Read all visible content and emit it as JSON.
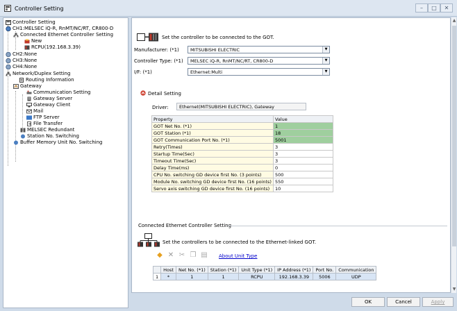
{
  "window": {
    "title": "Controller Setting",
    "icon": "controller-settings-icon"
  },
  "tree": {
    "items": [
      {
        "label": "Controller Setting",
        "icon": "controller-settings-icon"
      },
      {
        "label": "CH1:MELSEC iQ-R, RnMT/NC/RT, CR800-D",
        "icon": "channel-globe-icon"
      },
      {
        "label": "Connected Ethernet Controller Setting",
        "icon": "network-icon"
      },
      {
        "label": "New",
        "icon": "new-plc-icon"
      },
      {
        "label": "RCPU(192.168.3.39)",
        "icon": "plc-icon"
      },
      {
        "label": "CH2:None",
        "icon": "channel-globe-icon"
      },
      {
        "label": "CH3:None",
        "icon": "channel-globe-icon"
      },
      {
        "label": "CH4:None",
        "icon": "channel-globe-icon"
      },
      {
        "label": "Network/Duplex Setting",
        "icon": "network-icon"
      },
      {
        "label": "Routing Information",
        "icon": "routing-icon"
      },
      {
        "label": "Gateway",
        "icon": "gateway-icon"
      },
      {
        "label": "Communication Setting",
        "icon": "communication-icon"
      },
      {
        "label": "Gateway Server",
        "icon": "server-icon"
      },
      {
        "label": "Gateway Client",
        "icon": "client-icon"
      },
      {
        "label": "Mail",
        "icon": "mail-icon"
      },
      {
        "label": "FTP Server",
        "icon": "ftp-icon"
      },
      {
        "label": "File Transfer",
        "icon": "file-transfer-icon"
      },
      {
        "label": "MELSEC Redundant",
        "icon": "redundant-icon"
      },
      {
        "label": "Station No. Switching",
        "icon": "station-switch-icon"
      },
      {
        "label": "Buffer Memory Unit No. Switching",
        "icon": "buffer-switch-icon"
      }
    ]
  },
  "main": {
    "intro": "Set the controller to be connected to the GOT.",
    "manufacturer_label": "Manufacturer: (*1)",
    "manufacturer_value": "MITSUBISHI ELECTRIC",
    "controller_type_label": "Controller Type: (*1)",
    "controller_type_value": "MELSEC iQ-R, RnMT/NC/RT, CR800-D",
    "if_label": "I/F: (*1)",
    "if_value": "Ethernet:Multi",
    "detail_title": "Detail Setting",
    "driver_label": "Driver:",
    "driver_value": "Ethernet(MITSUBISHI ELECTRIC), Gateway",
    "prop_headers": {
      "property": "Property",
      "value": "Value"
    },
    "props": [
      {
        "name": "GOT Net No. (*1)",
        "value": "1",
        "highlight": true
      },
      {
        "name": "GOT Station (*1)",
        "value": "18",
        "highlight": true
      },
      {
        "name": "GOT Communication Port No. (*1)",
        "value": "5001",
        "highlight": true
      },
      {
        "name": "Retry(Times)",
        "value": "3",
        "highlight": false
      },
      {
        "name": "Startup Time(Sec)",
        "value": "3",
        "highlight": false
      },
      {
        "name": "Timeout Time(Sec)",
        "value": "3",
        "highlight": false
      },
      {
        "name": "Delay Time(ms)",
        "value": "0",
        "highlight": false
      },
      {
        "name": "CPU No. switching GD device first No. (3 points)",
        "value": "500",
        "highlight": false
      },
      {
        "name": "Module No. switching GD device first No. (16 points)",
        "value": "550",
        "highlight": false
      },
      {
        "name": "Servo axis switching GD device first No. (16 points)",
        "value": "10",
        "highlight": false
      }
    ],
    "connected_section_title": "Connected Ethernet Controller Setting",
    "connected_intro": "Set the controllers to be connected to the Ethernet-linked GOT.",
    "about_unit_type": "About Unit Type",
    "conn_headers": [
      "",
      "Host",
      "Net No. (*1)",
      "Station (*1)",
      "Unit Type (*1)",
      "IP Address (*1)",
      "Port No.",
      "Communication"
    ],
    "conn_rows": [
      [
        "1",
        "*",
        "1",
        "1",
        "RCPU",
        "192.168.3.39",
        "5006",
        "UDP"
      ]
    ]
  },
  "footer": {
    "ok": "OK",
    "cancel": "Cancel",
    "apply": "Apply"
  },
  "colors": {
    "highlight": "#9fcf9e",
    "link": "#0000cc",
    "accent": "#d04a3a"
  }
}
